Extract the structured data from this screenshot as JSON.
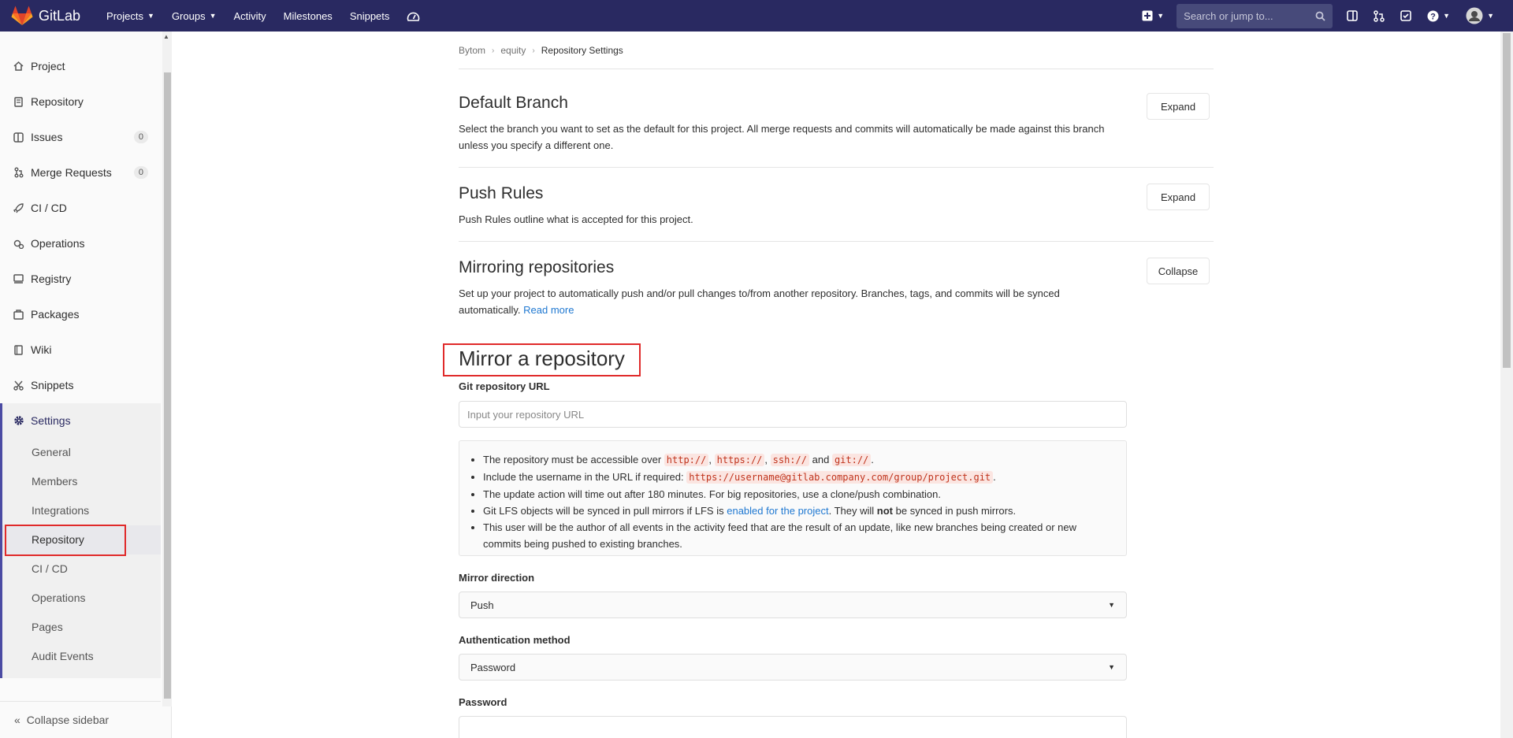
{
  "navbar": {
    "brand": "GitLab",
    "links": [
      {
        "label": "Projects",
        "dropdown": true
      },
      {
        "label": "Groups",
        "dropdown": true
      },
      {
        "label": "Activity",
        "dropdown": false
      },
      {
        "label": "Milestones",
        "dropdown": false
      },
      {
        "label": "Snippets",
        "dropdown": false
      }
    ],
    "search_placeholder": "Search or jump to...",
    "bg_color": "#292961"
  },
  "sidebar": {
    "items": [
      {
        "label": "Project",
        "icon": "home-icon"
      },
      {
        "label": "Repository",
        "icon": "doc-icon"
      },
      {
        "label": "Issues",
        "icon": "issues-icon",
        "count": "0"
      },
      {
        "label": "Merge Requests",
        "icon": "merge-icon",
        "count": "0"
      },
      {
        "label": "CI / CD",
        "icon": "rocket-icon"
      },
      {
        "label": "Operations",
        "icon": "cloud-gear-icon"
      },
      {
        "label": "Registry",
        "icon": "disk-icon"
      },
      {
        "label": "Packages",
        "icon": "package-icon"
      },
      {
        "label": "Wiki",
        "icon": "book-icon"
      },
      {
        "label": "Snippets",
        "icon": "scissors-icon"
      }
    ],
    "settings": {
      "label": "Settings",
      "icon": "gear-icon",
      "subitems": [
        "General",
        "Members",
        "Integrations",
        "Repository",
        "CI / CD",
        "Operations",
        "Pages",
        "Audit Events"
      ],
      "active": "Repository"
    },
    "collapse_label": "Collapse sidebar"
  },
  "breadcrumb": [
    "Bytom",
    "equity",
    "Repository Settings"
  ],
  "sections": {
    "default_branch": {
      "title": "Default Branch",
      "desc": "Select the branch you want to set as the default for this project. All merge requests and commits will automatically be made against this branch unless you specify a different one.",
      "button": "Expand"
    },
    "push_rules": {
      "title": "Push Rules",
      "desc": "Push Rules outline what is accepted for this project.",
      "button": "Expand"
    },
    "mirroring": {
      "title": "Mirroring repositories",
      "desc": "Set up your project to automatically push and/or pull changes to/from another repository. Branches, tags, and commits will be synced automatically.",
      "link": "Read more",
      "button": "Collapse"
    }
  },
  "mirror": {
    "title": "Mirror a repository",
    "url_label": "Git repository URL",
    "url_placeholder": "Input your repository URL",
    "help": {
      "line1_pre": "The repository must be accessible over",
      "protocols": [
        "http://",
        "https://",
        "ssh://",
        "git://"
      ],
      "and": "and",
      "line2_pre": "Include the username in the URL if required:",
      "example_url": "https://username@gitlab.company.com/group/project.git",
      "line3": "The update action will time out after 180 minutes. For big repositories, use a clone/push combination.",
      "line4_pre": "Git LFS objects will be synced in pull mirrors if LFS is",
      "line4_link": "enabled for the project",
      "line4_mid": ". They will",
      "line4_bold": "not",
      "line4_post": "be synced in push mirrors.",
      "line5": "This user will be the author of all events in the activity feed that are the result of an update, like new branches being created or new commits being pushed to existing branches."
    },
    "direction_label": "Mirror direction",
    "direction_value": "Push",
    "auth_label": "Authentication method",
    "auth_value": "Password",
    "password_label": "Password"
  }
}
